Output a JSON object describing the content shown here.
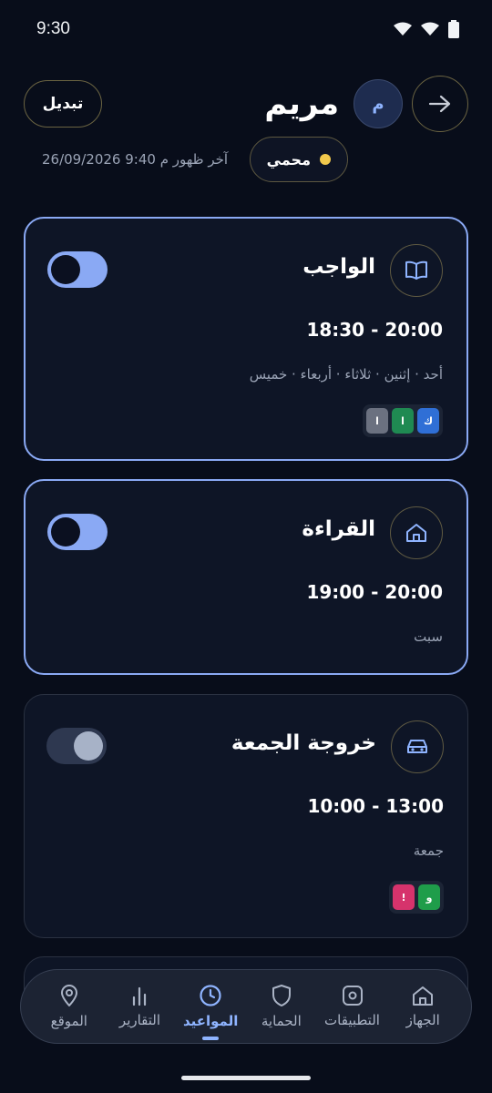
{
  "status_bar": {
    "time": "9:30"
  },
  "header": {
    "switch_label": "تبديل",
    "child_name": "مريم",
    "avatar_initial": "م",
    "protection_status": "محمي",
    "last_seen": "آخر ظهور م 9:40 26/09/2026"
  },
  "schedules": [
    {
      "title": "الواجب",
      "icon": "book-icon",
      "time": "18:30 - 20:00",
      "days": "أحد · إثنين · ثلاثاء · أربعاء · خميس",
      "enabled": true,
      "apps": [
        {
          "letter": "ك",
          "color": "#2f6fd6"
        },
        {
          "letter": "ا",
          "color": "#1f8a52"
        },
        {
          "letter": "ا",
          "color": "#6b7180"
        }
      ]
    },
    {
      "title": "القراءة",
      "icon": "home-icon",
      "time": "19:00 - 20:00",
      "days": "سبت",
      "enabled": true,
      "apps": []
    },
    {
      "title": "خروجة الجمعة",
      "icon": "car-icon",
      "time": "10:00 - 13:00",
      "days": "جمعة",
      "enabled": false,
      "apps": [
        {
          "letter": "و",
          "color": "#1f9d4a"
        },
        {
          "letter": "!",
          "color": "#d6336c"
        }
      ]
    }
  ],
  "nav": {
    "items": [
      {
        "label": "الجهاز",
        "icon": "home-icon"
      },
      {
        "label": "التطبيقات",
        "icon": "apps-icon"
      },
      {
        "label": "الحماية",
        "icon": "shield-icon"
      },
      {
        "label": "المواعيد",
        "icon": "clock-icon",
        "active": true
      },
      {
        "label": "التقارير",
        "icon": "bar-chart-icon"
      },
      {
        "label": "الموقع",
        "icon": "location-pin-icon"
      }
    ]
  },
  "colors": {
    "background": "#080d1a",
    "accent": "#8aa9f4",
    "active_nav": "#8fb4ff",
    "protected_dot": "#f2c94c"
  }
}
